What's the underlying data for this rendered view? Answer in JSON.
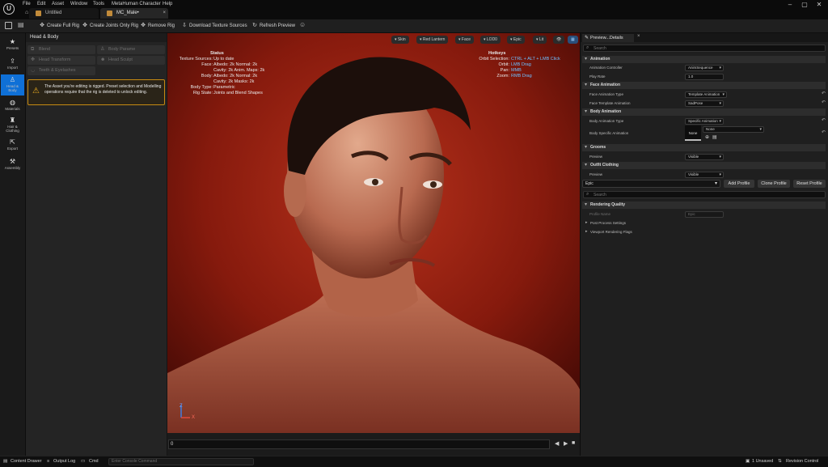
{
  "menu": {
    "items": [
      "File",
      "Edit",
      "Asset",
      "Window",
      "Tools",
      "MetaHuman Character",
      "Help"
    ]
  },
  "tabs": [
    {
      "label": "Untitled"
    },
    {
      "label": "MC_Male•"
    }
  ],
  "toolbar": {
    "create_full_rig": "Create Full Rig",
    "create_joints_only_rig": "Create Joints Only Rig",
    "remove_rig": "Remove Rig",
    "download_texture_sources": "Download Texture Sources",
    "refresh_preview": "Refresh Preview"
  },
  "strip": {
    "items": [
      {
        "label": "Presets",
        "icon": "star-icon"
      },
      {
        "label": "Import",
        "icon": "person-icon"
      },
      {
        "label": "Head &\nBody",
        "icon": "body-icon"
      },
      {
        "label": "Materials",
        "icon": "materials-icon"
      },
      {
        "label": "Hair &\nClothing",
        "icon": "hair-icon"
      },
      {
        "label": "Export",
        "icon": "export-icon"
      },
      {
        "label": "Assembly",
        "icon": "hammer-icon"
      }
    ]
  },
  "left_panel": {
    "title": "Head & Body",
    "buttons": [
      "Blend",
      "Body Parame",
      "Head Transform",
      "Head Sculpt",
      "Teeth & Eyelashes"
    ],
    "warning": "The Asset you're editing is rigged. Preset selection and Modelling operations require that the rig is deleted to unlock editing."
  },
  "viewport": {
    "pills": [
      "Skin",
      "Red Lantern",
      "Face",
      "LOD0",
      "Epic",
      "Lit",
      "",
      ""
    ],
    "status": {
      "title": "Status",
      "rows": [
        {
          "label": "Texture Sources:",
          "value": "Up to date"
        },
        {
          "label": "Face:",
          "value": "Albedo: 2k Normal: 2k"
        },
        {
          "label": "",
          "value": "Cavity: 2k  Anim. Maps: 2k"
        },
        {
          "label": "Body:",
          "value": "Albedo: 2k Normal: 2k"
        },
        {
          "label": "",
          "value": "Cavity: 2k  Masks: 2k"
        },
        {
          "label": "Body Type:",
          "value": "Parametric"
        },
        {
          "label": "Rig State:",
          "value": "Joints and Blend Shapes"
        }
      ]
    },
    "hotkeys": {
      "title": "Hotkeys",
      "rows": [
        {
          "label": "Orbit Selection:",
          "value": "CTRL + ALT + LMB Click"
        },
        {
          "label": "Orbit:",
          "value": "LMB Drag"
        },
        {
          "label": "Pan:",
          "value": "MMB"
        },
        {
          "label": "Zoom:",
          "value": "RMB Drag"
        }
      ]
    },
    "axis_x": "X",
    "axis_z": "Z",
    "timeline_value": "0"
  },
  "right_panel": {
    "tab_title": "Preview...Details",
    "search_placeholder": "Search",
    "sections": {
      "animation": "Animation",
      "face_animation": "Face Animation",
      "body_animation": "Body Animation",
      "grooms": "Grooms",
      "outfit_clothing": "Outfit Clothing"
    },
    "props": {
      "animation_controller": {
        "label": "Animation Controller",
        "value": "AnimSequence"
      },
      "play_rate": {
        "label": "Play Rate",
        "value": "1.0"
      },
      "face_animation_type": {
        "label": "Face Animation Type",
        "value": "Template Animation"
      },
      "face_template_animation": {
        "label": "Face Template Animation",
        "value": "SadPose"
      },
      "body_animation_type": {
        "label": "Body Animation Type",
        "value": "Specific Animation"
      },
      "body_specific_animation": {
        "label": "Body Specific Animation",
        "value": "None",
        "thumb": "None"
      },
      "grooms_preview": {
        "label": "Preview",
        "value": "Visible"
      },
      "outfit_preview": {
        "label": "Preview",
        "value": "Visible"
      }
    },
    "profile": {
      "selected": "Epic",
      "add": "Add Profile",
      "clone": "Clone Profile",
      "reset": "Reset Profile",
      "search_placeholder": "Search"
    },
    "rendering": {
      "section": "Rendering Quality",
      "profile_name_label": "Profile Name",
      "profile_name_value": "Epic",
      "post_process": "Post Process Settings",
      "viewport_flags": "Viewport Rendering Flags"
    }
  },
  "statusbar": {
    "content_drawer": "Content Drawer",
    "output_log": "Output Log",
    "cmd": "Cmd",
    "console_placeholder": "Enter Console Command",
    "unsaved": "1 Unsaved",
    "revision_control": "Revision Control"
  }
}
